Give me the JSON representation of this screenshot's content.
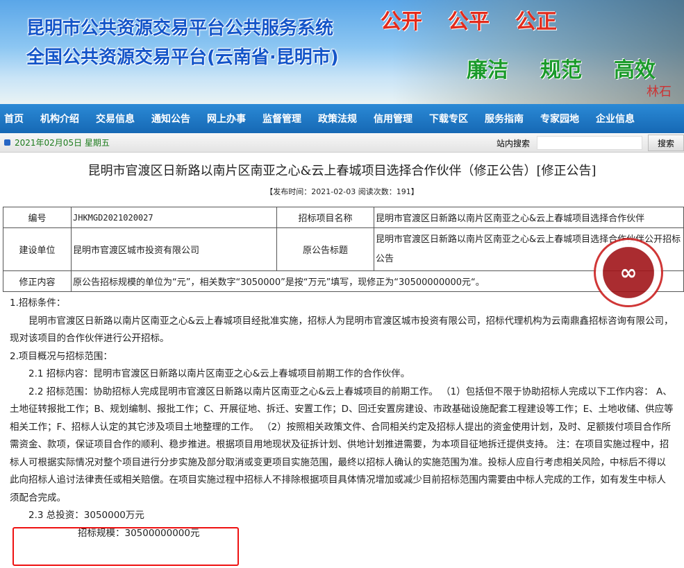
{
  "header": {
    "title1": "昆明市公共资源交易平台公共服务系统",
    "title2": "全国公共资源交易平台(云南省·昆明市)",
    "slogans_red": [
      "公开",
      "公平",
      "公正"
    ],
    "slogans_green": [
      "廉洁",
      "规范",
      "高效"
    ],
    "stamp": "林石"
  },
  "nav": [
    "首页",
    "机构介绍",
    "交易信息",
    "通知公告",
    "网上办事",
    "监督管理",
    "政策法规",
    "信用管理",
    "下载专区",
    "服务指南",
    "专家园地",
    "企业信息"
  ],
  "datebar": {
    "date": "2021年02月05日  星期五",
    "search_label": "站内搜索",
    "search_value": "",
    "search_button": "搜索"
  },
  "article": {
    "title": "昆明市官渡区日新路以南片区南亚之心&云上春城项目选择合作伙伴（修正公告）[修正公告]",
    "meta": "【发布时间：2021-02-03  阅读次数：191】"
  },
  "table": {
    "r1": [
      "编号",
      "JHKMGD2021020027",
      "招标项目名称",
      "昆明市官渡区日新路以南片区南亚之心&云上春城项目选择合作伙伴"
    ],
    "r2": [
      "建设单位",
      "昆明市官渡区城市投资有限公司",
      "原公告标题",
      "昆明市官渡区日新路以南片区南亚之心&云上春城项目选择合作伙伴公开招标公告"
    ],
    "r3": [
      "修正内容",
      "原公告招标规模的单位为“元”，相关数字“3050000”是按“万元”填写，现修正为“30500000000元“。"
    ]
  },
  "body": {
    "p1": "1.招标条件：",
    "p2": "昆明市官渡区日新路以南片区南亚之心&云上春城项目经批准实施，招标人为昆明市官渡区城市投资有限公司，招标代理机构为云南鼎鑫招标咨询有限公司，现对该项目的合作伙伴进行公开招标。",
    "p3": "2.项目概况与招标范围：",
    "p4": "2.1 招标内容：昆明市官渡区日新路以南片区南亚之心&云上春城项目前期工作的合作伙伴。",
    "p5": "2.2 招标范围：协助招标人完成昆明市官渡区日新路以南片区南亚之心&云上春城项目的前期工作。 （1）包括但不限于协助招标人完成以下工作内容： A、土地征转报批工作；B、规划编制、报批工作；C、开展征地、拆迁、安置工作；D、回迁安置房建设、市政基础设施配套工程建设等工作；E、土地收储、供应等相关工作；F、招标人认定的其它涉及项目土地整理的工作。 （2）按照相关政策文件、合同相关约定及招标人提出的资金使用计划，及时、足额拨付项目合作所需资金、款项，保证项目合作的顺利、稳步推进。根据项目用地现状及征拆计划、供地计划推进需要，为本项目征地拆迁提供支持。 注：在项目实施过程中，招标人可根据实际情况对整个项目进行分步实施及部分取消或变更项目实施范围，最终以招标人确认的实施范围为准。投标人应自行考虑相关风险，中标后不得以此向招标人追讨法律责任或相关赔偿。在项目实施过程中招标人不排除根据项目具体情况增加或减少目前招标范围内需要由中标人完成的工作，如有发生中标人须配合完成。",
    "p6": "2.3 总投资：3050000万元",
    "p7": "招标规模：30500000000元"
  }
}
